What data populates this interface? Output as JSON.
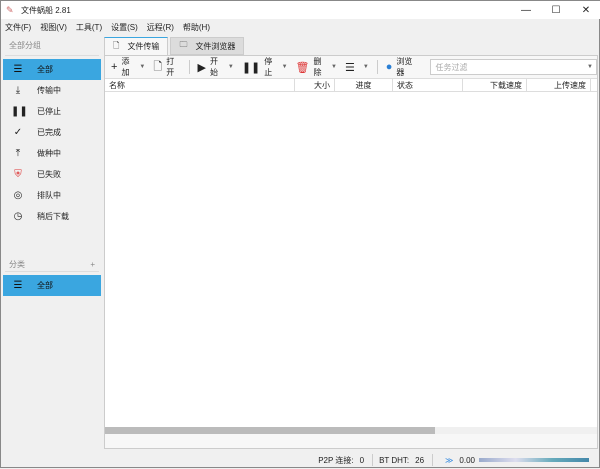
{
  "app": {
    "title": "文件蜗船 2.81"
  },
  "menu": [
    "文件(F)",
    "视图(V)",
    "工具(T)",
    "设置(S)",
    "远程(R)",
    "帮助(H)"
  ],
  "sidebar": {
    "group_label": "全部分组",
    "items": [
      {
        "label": "全部",
        "icon": "menu-icon",
        "glyph": "☰"
      },
      {
        "label": "传输中",
        "icon": "download-icon",
        "glyph": "⤓"
      },
      {
        "label": "已停止",
        "icon": "pause-icon",
        "glyph": "❚❚"
      },
      {
        "label": "已完成",
        "icon": "check-icon",
        "glyph": "✓"
      },
      {
        "label": "做种中",
        "icon": "upload-icon",
        "glyph": "⤒"
      },
      {
        "label": "已失败",
        "icon": "shield-alert-icon",
        "glyph": "⛨"
      },
      {
        "label": "排队中",
        "icon": "compass-icon",
        "glyph": "◎"
      },
      {
        "label": "稍后下载",
        "icon": "clock-icon",
        "glyph": "◷"
      }
    ],
    "category_label": "分类",
    "add": "+",
    "category_items": [
      {
        "label": "全部",
        "glyph": "☰"
      }
    ]
  },
  "tabs": [
    {
      "label": "文件传输"
    },
    {
      "label": "文件浏览器"
    }
  ],
  "toolbar": {
    "add": "添加",
    "open": "打开",
    "start": "开始",
    "stop": "停止",
    "delete": "删除",
    "browser": "浏览器",
    "filter_placeholder": "任务过滤"
  },
  "columns": [
    "名称",
    "大小",
    "进度",
    "状态",
    "下载速度",
    "上传速度"
  ],
  "status": {
    "p2p_label": "P2P 连接:",
    "p2p": "0",
    "dht_label": "BT DHT:",
    "dht": "26",
    "speed": "0.00"
  }
}
